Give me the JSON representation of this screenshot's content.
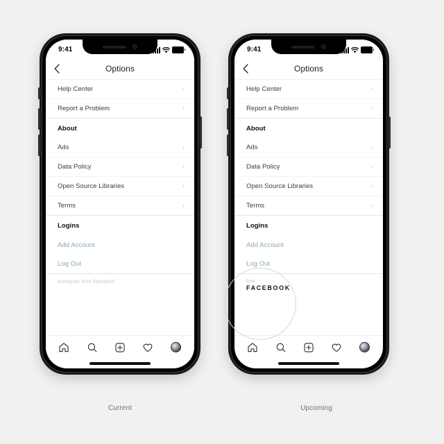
{
  "page": {
    "background_color": "#f1f1f1"
  },
  "captions": {
    "left": "Current",
    "right": "Upcoming"
  },
  "status_bar": {
    "time": "9:41",
    "signal_icon": "cellular-signal-icon",
    "wifi_icon": "wifi-icon",
    "battery_icon": "battery-icon"
  },
  "nav": {
    "back_icon": "chevron-left-icon",
    "title": "Options"
  },
  "list": {
    "rows": [
      {
        "label": "Help Center",
        "type": "link-row",
        "chevron": "›"
      },
      {
        "label": "Report a Problem",
        "type": "link-row",
        "chevron": "›"
      },
      {
        "label": "About",
        "type": "section-header",
        "chevron": ""
      },
      {
        "label": "Ads",
        "type": "link-row",
        "chevron": "›"
      },
      {
        "label": "Data Policy",
        "type": "link-row",
        "chevron": "›"
      },
      {
        "label": "Open Source Libraries",
        "type": "link-row",
        "chevron": "›"
      },
      {
        "label": "Terms",
        "type": "link-row",
        "chevron": "›"
      },
      {
        "label": "Logins",
        "type": "section-header",
        "chevron": ""
      },
      {
        "label": "Add Account",
        "type": "action-link",
        "chevron": ""
      },
      {
        "label": "Log Out",
        "type": "action-link",
        "chevron": ""
      }
    ]
  },
  "branding": {
    "current": {
      "text": "Instagram from Facebook"
    },
    "upcoming": {
      "from": "from",
      "wordmark": "FACEBOOK"
    }
  },
  "tabbar": {
    "items": [
      {
        "icon": "home-icon"
      },
      {
        "icon": "search-icon"
      },
      {
        "icon": "add-post-icon"
      },
      {
        "icon": "heart-icon"
      },
      {
        "icon": "profile-avatar-icon"
      }
    ]
  },
  "colors": {
    "link_blue": "#8ba6b5",
    "text_primary": "#3c3c41",
    "header_text": "#101012",
    "muted": "#c7cace",
    "chevron": "#c9ccd0"
  }
}
